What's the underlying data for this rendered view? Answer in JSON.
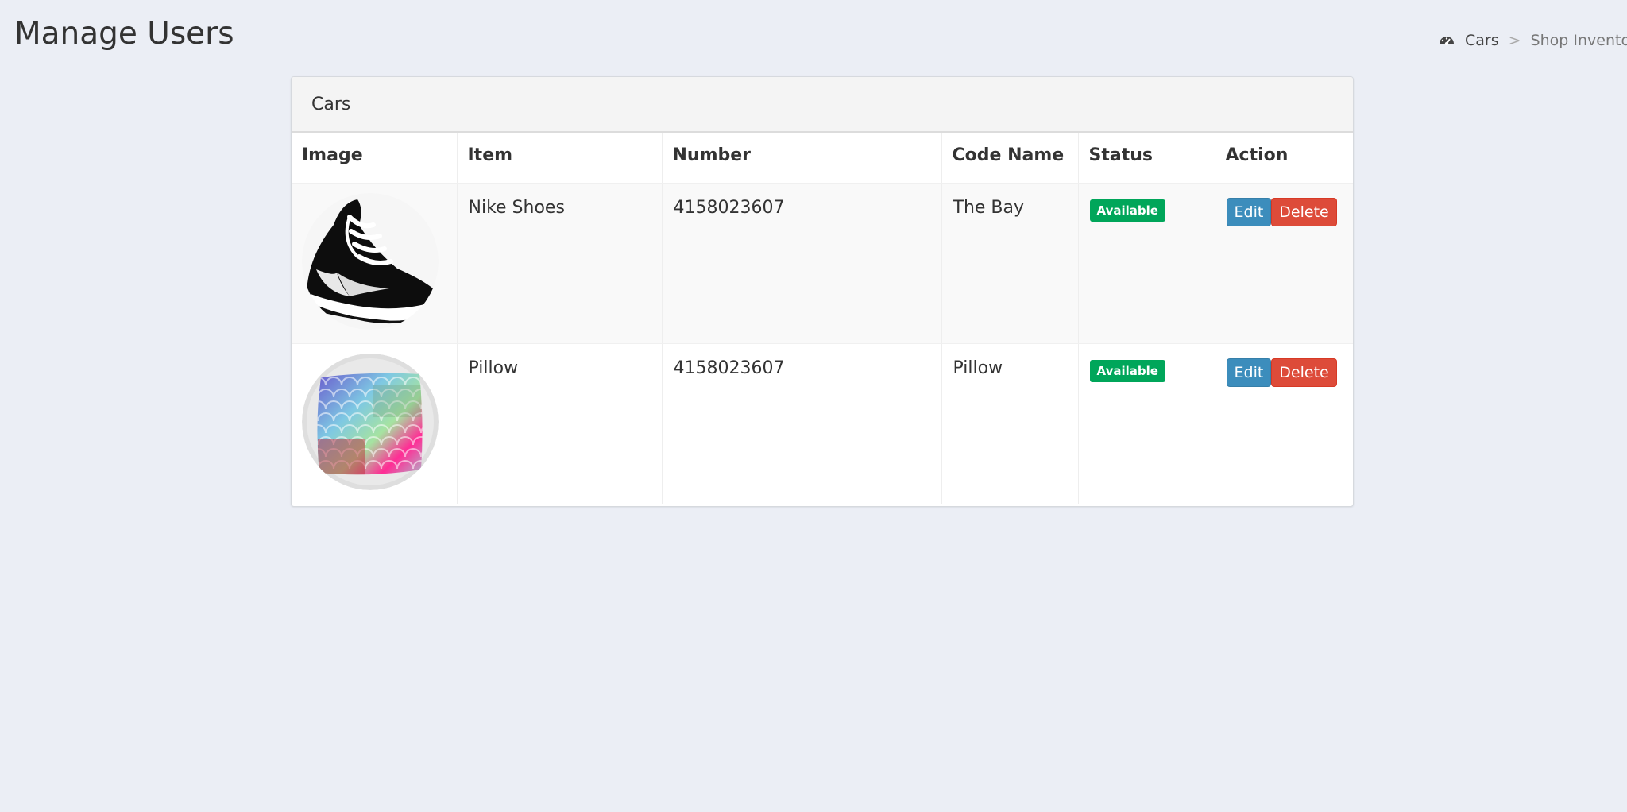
{
  "header": {
    "title": "Manage Users"
  },
  "breadcrumb": {
    "home_icon": "dashboard-icon",
    "home_label": "Cars",
    "separator": ">",
    "current_label": "Shop Inventory"
  },
  "panel": {
    "title": "Cars"
  },
  "table": {
    "columns": [
      "Image",
      "Item",
      "Number",
      "Code Name",
      "Status",
      "Action"
    ],
    "rows": [
      {
        "image": "nike-shoe-image",
        "item": "Nike Shoes",
        "number": "4158023607",
        "code_name": "The Bay",
        "status": "Available",
        "edit_label": "Edit",
        "delete_label": "Delete"
      },
      {
        "image": "pillow-image",
        "item": "Pillow",
        "number": "4158023607",
        "code_name": "Pillow",
        "status": "Available",
        "edit_label": "Edit",
        "delete_label": "Delete"
      }
    ]
  },
  "colors": {
    "background": "#ebeef5",
    "status_available": "#00a65a",
    "edit_button": "#3c8dbc",
    "delete_button": "#dd4b39"
  }
}
